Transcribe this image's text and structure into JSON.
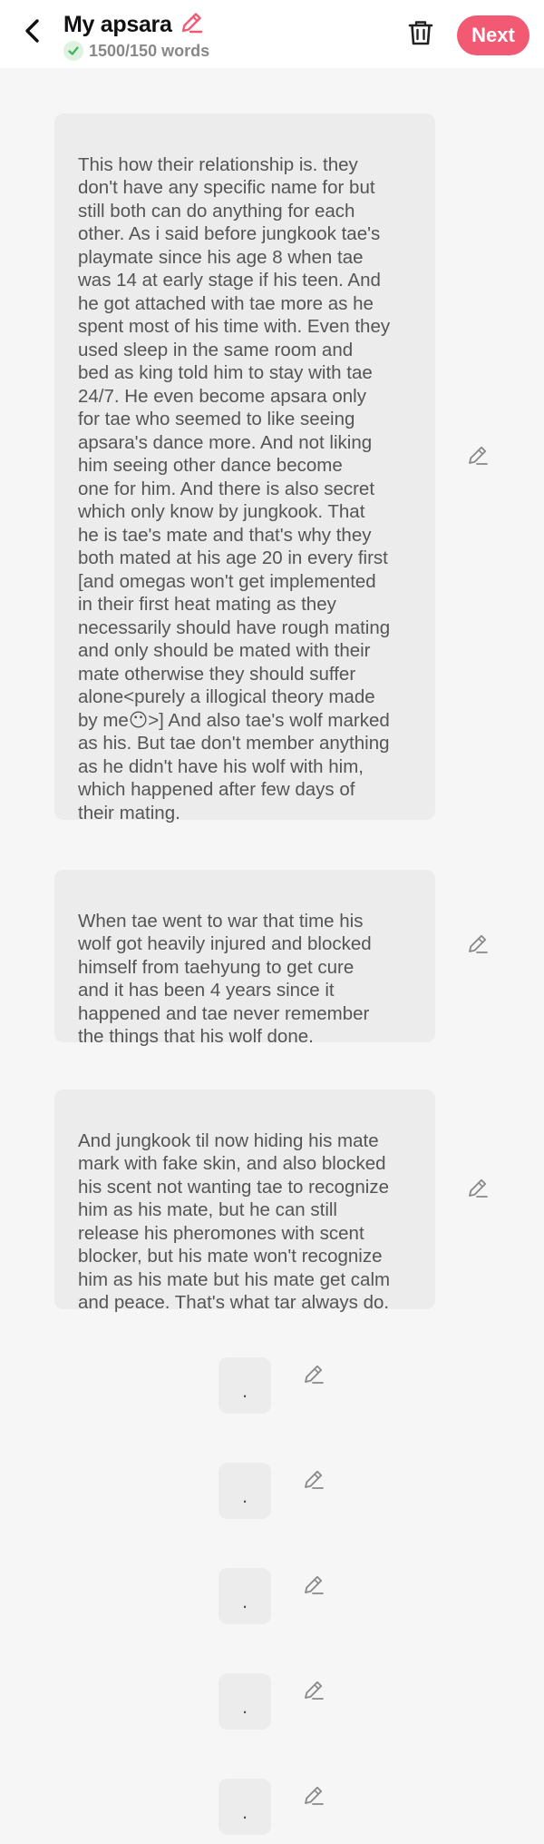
{
  "header": {
    "title": "My apsara",
    "word_count": "1500/150 words",
    "next_label": "Next"
  },
  "paragraphs": [
    {
      "text": "This how their relationship is. they\ndon't have any specific name for but\nstill both can do anything for each\nother. As i said before jungkook tae's\nplaymate since his age 8 when tae\nwas 14 at early stage if his teen. And\nhe got attached with tae more as he\nspent most of his time with. Even they\nused sleep in the same room and\nbed as king told him to stay with tae\n24/7. He even become apsara only\nfor tae who seemed to like seeing\napsara's dance more. And not liking\nhim seeing other dance become\none for him. And there is also secret\nwhich only know by jungkook. That\nhe is tae's mate and that's why they\nboth mated at his age 20 in every first\n[and omegas won't get implemented\nin their first heat mating as they\nnecessarily should have rough mating\nand only should be mated with their\nmate otherwise they should suffer\nalone<purely a illogical theory made\nby me😶>] And also tae's wolf marked\nas his. But tae don't member anything\nas he didn't have his wolf with him,\nwhich happened after few days of\ntheir mating."
    },
    {
      "text": "When tae went to war that time his\nwolf got heavily injured and blocked\nhimself from taehyung to get cure\nand it has been 4 years since it\nhappened and tae never remember\nthe things that his wolf done."
    },
    {
      "text": "And jungkook til now hiding his mate\nmark with fake skin, and also blocked\nhis scent not wanting tae to recognize\nhim as his mate, but he can still\nrelease his pheromones with scent\nblocker, but his mate won't recognize\nhim as his mate but his mate get calm\nand peace. That's what tar always do."
    },
    {
      "text": "."
    },
    {
      "text": "."
    },
    {
      "text": "."
    },
    {
      "text": "."
    },
    {
      "text": "."
    }
  ],
  "icons": {
    "back": "back-arrow-icon",
    "edit_title": "pencil-icon",
    "check": "check-icon",
    "delete": "trash-icon",
    "edit_paragraph": "pencil-icon"
  },
  "colors": {
    "accent": "#f25a73",
    "check_green": "#3cb55a",
    "card_bg": "#ececec",
    "page_bg": "#f6f6f6"
  }
}
